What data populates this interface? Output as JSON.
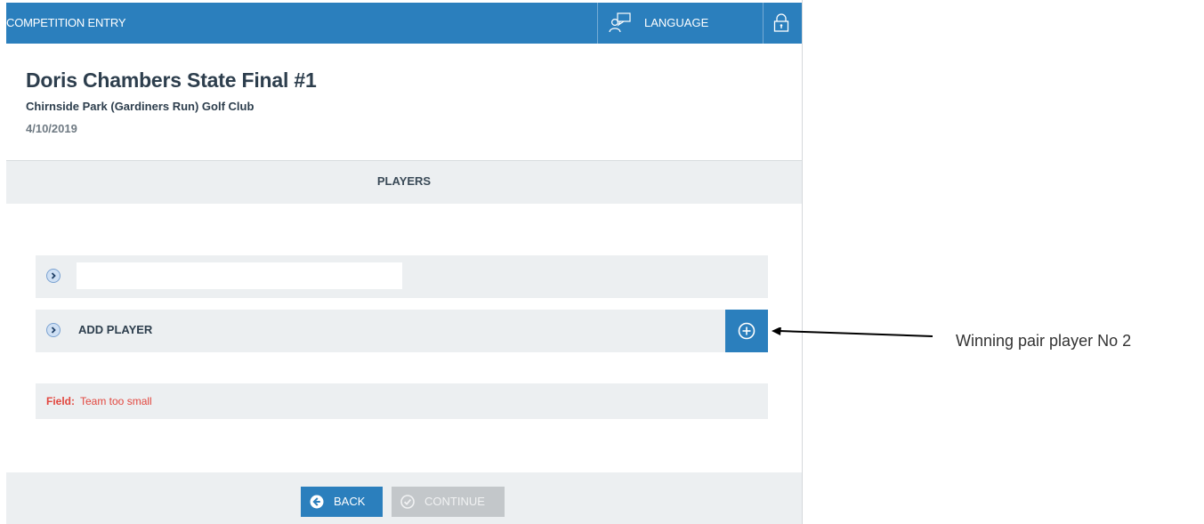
{
  "header": {
    "title": "COMPETITION ENTRY",
    "language_label": "LANGUAGE",
    "icons": {
      "language": "language-chat-icon",
      "lock": "lock-icon"
    }
  },
  "competition": {
    "name": "Doris Chambers State Final #1",
    "club": "Chirnside Park (Gardiners Run) Golf Club",
    "date": "4/10/2019"
  },
  "section": {
    "title": "PLAYERS"
  },
  "players": {
    "player_1_value": "",
    "add_player_label": "ADD PLAYER"
  },
  "validation": {
    "label": "Field:",
    "message": "Team too small"
  },
  "footer": {
    "back_label": "BACK",
    "continue_label": "CONTINUE"
  },
  "annotation": {
    "text": "Winning pair player No 2"
  },
  "colors": {
    "primary": "#2b7fbd",
    "panel": "#eceff1",
    "error": "#e2473f",
    "disabled": "#c3c7ca"
  }
}
